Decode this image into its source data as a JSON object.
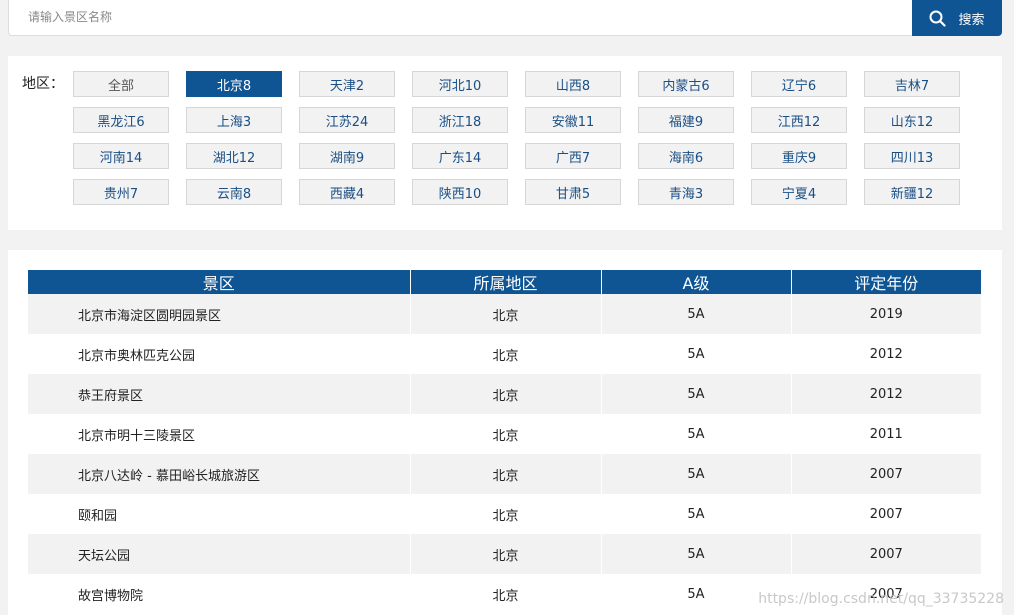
{
  "search": {
    "placeholder": "请输入景区名称",
    "button_label": "搜索"
  },
  "regions": {
    "label": "地区：",
    "active": "北京8",
    "items": [
      "全部",
      "北京8",
      "天津2",
      "河北10",
      "山西8",
      "内蒙古6",
      "辽宁6",
      "吉林7",
      "黑龙江6",
      "上海3",
      "江苏24",
      "浙江18",
      "安徽11",
      "福建9",
      "江西12",
      "山东12",
      "河南14",
      "湖北12",
      "湖南9",
      "广东14",
      "广西7",
      "海南6",
      "重庆9",
      "四川13",
      "贵州7",
      "云南8",
      "西藏4",
      "陕西10",
      "甘肃5",
      "青海3",
      "宁夏4",
      "新疆12"
    ]
  },
  "table": {
    "headers": [
      "景区",
      "所属地区",
      "A级",
      "评定年份"
    ],
    "rows": [
      [
        "北京市海淀区圆明园景区",
        "北京",
        "5A",
        "2019"
      ],
      [
        "北京市奥林匹克公园",
        "北京",
        "5A",
        "2012"
      ],
      [
        "恭王府景区",
        "北京",
        "5A",
        "2012"
      ],
      [
        "北京市明十三陵景区",
        "北京",
        "5A",
        "2011"
      ],
      [
        "北京八达岭 - 慕田峪长城旅游区",
        "北京",
        "5A",
        "2007"
      ],
      [
        "颐和园",
        "北京",
        "5A",
        "2007"
      ],
      [
        "天坛公园",
        "北京",
        "5A",
        "2007"
      ],
      [
        "故宫博物院",
        "北京",
        "5A",
        "2007"
      ]
    ]
  },
  "watermark": "https://blog.csdn.net/qq_33735228",
  "colors": {
    "brand": "#0f5594",
    "panel_bg": "#ffffff",
    "page_bg": "#f2f2f2"
  }
}
